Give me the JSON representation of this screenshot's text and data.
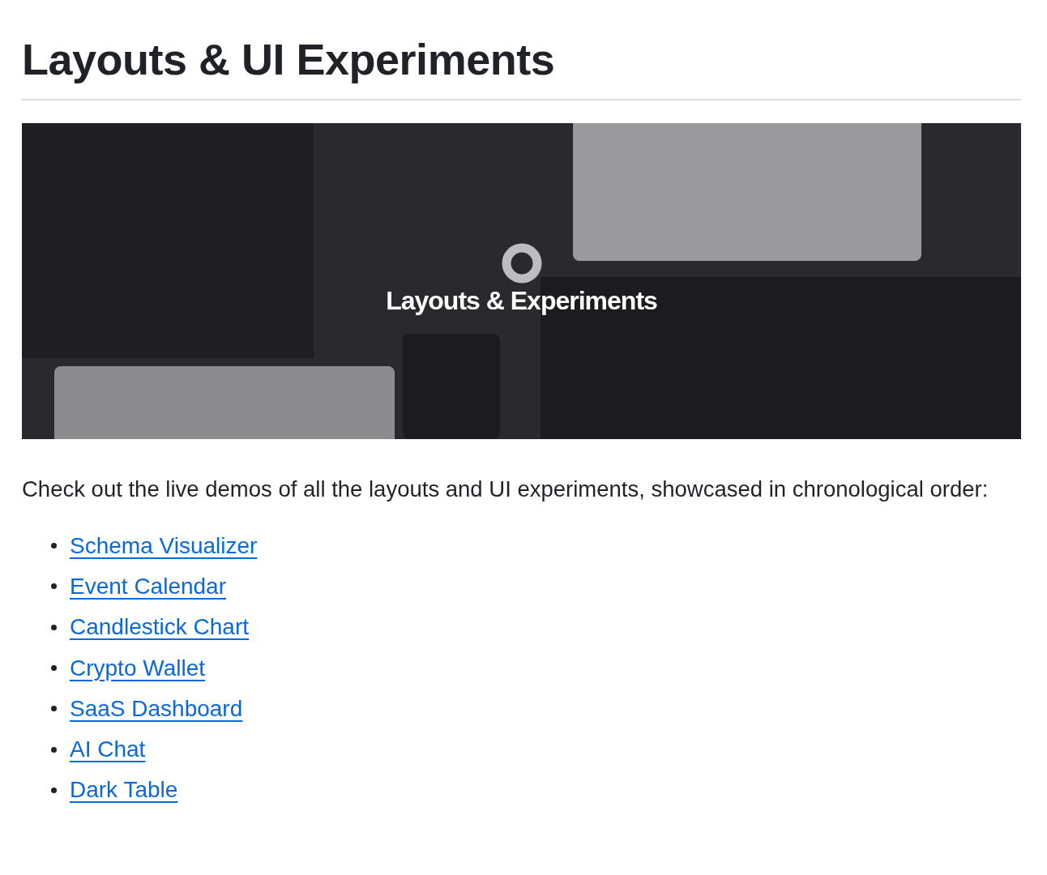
{
  "heading": "Layouts & UI Experiments",
  "banner": {
    "title": "Layouts & Experiments"
  },
  "intro": "Check out the live demos of all the layouts and UI experiments, showcased in chronological order:",
  "links": [
    "Schema Visualizer",
    "Event Calendar",
    "Candlestick Chart",
    "Crypto Wallet",
    "SaaS Dashboard",
    "AI Chat",
    "Dark Table"
  ]
}
